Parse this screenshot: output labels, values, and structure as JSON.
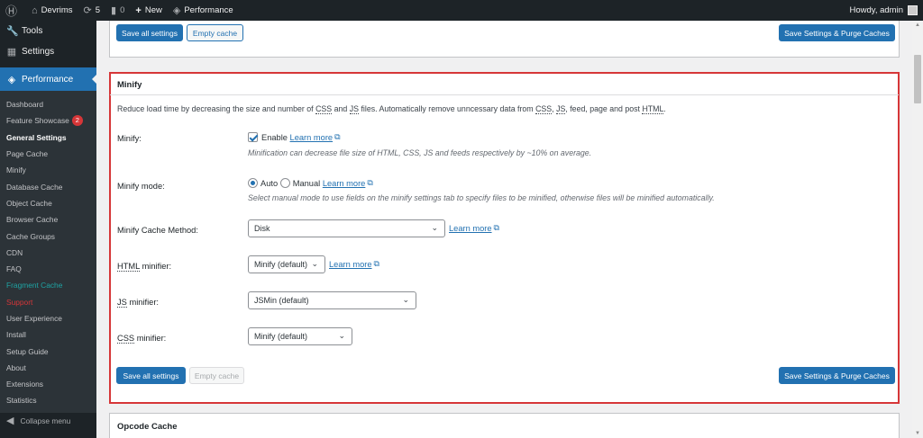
{
  "adminbar": {
    "wp_logo": "wordpress-icon",
    "site_name": "Devrims",
    "updates_count": "5",
    "comments_count": "0",
    "new_label": "New",
    "performance_label": "Performance",
    "howdy": "Howdy, admin"
  },
  "sidebar": {
    "tools": "Tools",
    "settings": "Settings",
    "performance": "Performance",
    "items": [
      {
        "label": "Dashboard"
      },
      {
        "label": "Feature Showcase",
        "badge": "2"
      },
      {
        "label": "General Settings"
      },
      {
        "label": "Page Cache"
      },
      {
        "label": "Minify"
      },
      {
        "label": "Database Cache"
      },
      {
        "label": "Object Cache"
      },
      {
        "label": "Browser Cache"
      },
      {
        "label": "Cache Groups"
      },
      {
        "label": "CDN"
      },
      {
        "label": "FAQ"
      },
      {
        "label": "Fragment Cache",
        "color": "#1ea3a3"
      },
      {
        "label": "Support",
        "color": "#d63638"
      },
      {
        "label": "User Experience"
      },
      {
        "label": "Install"
      },
      {
        "label": "Setup Guide"
      },
      {
        "label": "About"
      },
      {
        "label": "Extensions"
      },
      {
        "label": "Statistics"
      }
    ],
    "collapse": "Collapse menu"
  },
  "top_box": {
    "save_all": "Save all settings",
    "empty_cache": "Empty cache",
    "save_purge": "Save Settings & Purge Caches"
  },
  "minify": {
    "title": "Minify",
    "intro_pre": "Reduce load time by decreasing the size and number of ",
    "css": "CSS",
    "and": " and ",
    "js": "JS",
    "intro_mid": " files. Automatically remove unncessary data from ",
    "comma": ", ",
    "intro_post": ", feed, page and post ",
    "html": "HTML",
    "period": ".",
    "minify_label": "Minify:",
    "enable_label": "Enable",
    "learn_more": "Learn more",
    "minify_desc": "Minification can decrease file size of HTML, CSS, JS and feeds respectively by ~10% on average.",
    "mode_label": "Minify mode:",
    "auto_label": "Auto",
    "manual_label": "Manual",
    "mode_desc": "Select manual mode to use fields on the minify settings tab to specify files to be minified, otherwise files will be minified automatically.",
    "cache_method_label": "Minify Cache Method:",
    "cache_method_value": "Disk",
    "html_minifier_label": "minifier:",
    "html_minifier_value": "Minify (default)",
    "js_minifier_label": "minifier:",
    "js_minifier_value": "JSMin (default)",
    "css_minifier_label": "minifier:",
    "css_minifier_value": "Minify (default)",
    "save_all": "Save all settings",
    "empty_cache": "Empty cache",
    "save_purge": "Save Settings & Purge Caches",
    "highlight_color": "#d63638"
  },
  "opcode": {
    "title": "Opcode Cache"
  }
}
